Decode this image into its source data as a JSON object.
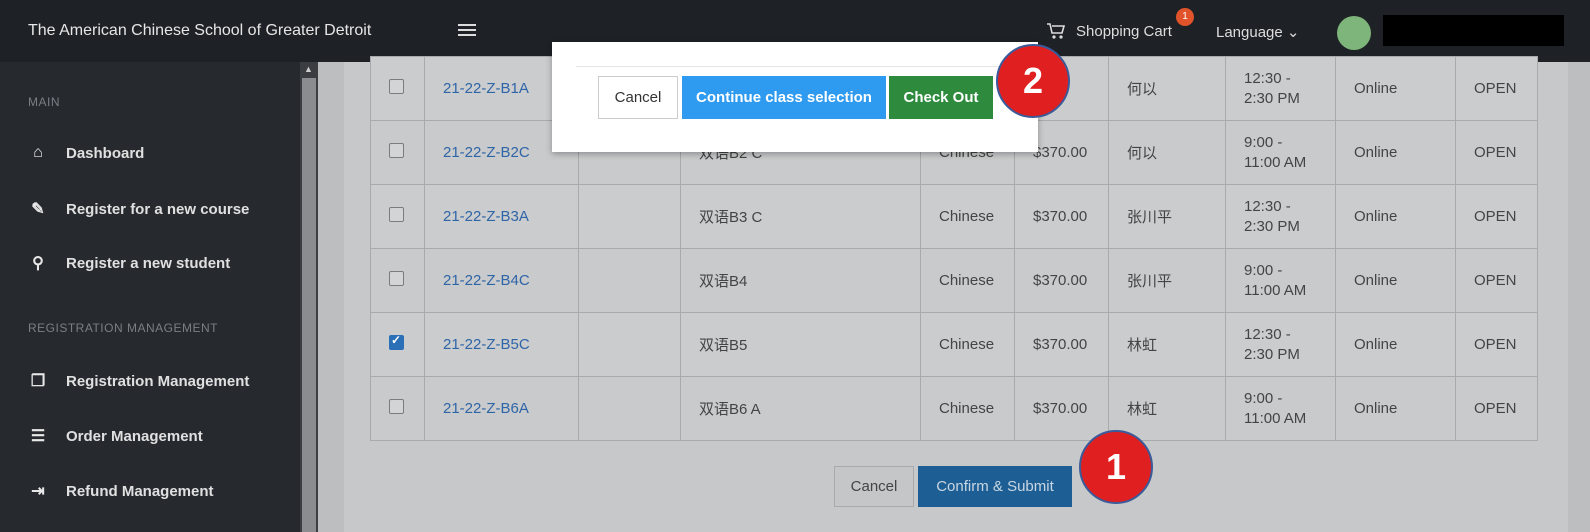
{
  "topbar": {
    "brand": "The American Chinese School of Greater Detroit",
    "cart_label": "Shopping Cart",
    "cart_count": "1",
    "language_label": "Language ⌄"
  },
  "sidebar": {
    "sections": [
      {
        "label": "MAIN"
      },
      {
        "label": "REGISTRATION MANAGEMENT"
      }
    ],
    "items": [
      {
        "label": "Dashboard",
        "icon": "home-icon"
      },
      {
        "label": "Register for a new course",
        "icon": "edit-icon"
      },
      {
        "label": "Register a new student",
        "icon": "user-add-icon"
      },
      {
        "label": "Registration Management",
        "icon": "copy-icon"
      },
      {
        "label": "Order Management",
        "icon": "list-icon"
      },
      {
        "label": "Refund Management",
        "icon": "refund-icon"
      }
    ]
  },
  "table": {
    "rows": [
      {
        "checked": false,
        "code": "21-22-Z-B1A",
        "blank": "",
        "name": "",
        "lang": "",
        "price": "00",
        "teacher": "何以",
        "time": "12:30 -\n2:30 PM",
        "mode": "Online",
        "status": "OPEN"
      },
      {
        "checked": false,
        "code": "21-22-Z-B2C",
        "blank": "",
        "name": "双语B2 C",
        "lang": "Chinese",
        "price": "$370.00",
        "teacher": "何以",
        "time": "9:00 -\n11:00 AM",
        "mode": "Online",
        "status": "OPEN"
      },
      {
        "checked": false,
        "code": "21-22-Z-B3A",
        "blank": "",
        "name": "双语B3 C",
        "lang": "Chinese",
        "price": "$370.00",
        "teacher": "张川平",
        "time": "12:30 -\n2:30 PM",
        "mode": "Online",
        "status": "OPEN"
      },
      {
        "checked": false,
        "code": "21-22-Z-B4C",
        "blank": "",
        "name": "双语B4",
        "lang": "Chinese",
        "price": "$370.00",
        "teacher": "张川平",
        "time": "9:00 -\n11:00 AM",
        "mode": "Online",
        "status": "OPEN"
      },
      {
        "checked": true,
        "code": "21-22-Z-B5C",
        "blank": "",
        "name": "双语B5",
        "lang": "Chinese",
        "price": "$370.00",
        "teacher": "林虹",
        "time": "12:30 -\n2:30 PM",
        "mode": "Online",
        "status": "OPEN"
      },
      {
        "checked": false,
        "code": "21-22-Z-B6A",
        "blank": "",
        "name": "双语B6 A",
        "lang": "Chinese",
        "price": "$370.00",
        "teacher": "林虹",
        "time": "9:00 -\n11:00 AM",
        "mode": "Online",
        "status": "OPEN"
      }
    ]
  },
  "footer_actions": {
    "cancel_label": "Cancel",
    "confirm_label": "Confirm & Submit"
  },
  "modal": {
    "cancel_label": "Cancel",
    "continue_label": "Continue class selection",
    "checkout_label": "Check Out"
  },
  "annotations": {
    "step1": "1",
    "step2": "2"
  },
  "colors": {
    "accent_blue": "#2f9bf0",
    "checkout_green": "#2e8b3e",
    "annotation_red": "#e02020"
  }
}
